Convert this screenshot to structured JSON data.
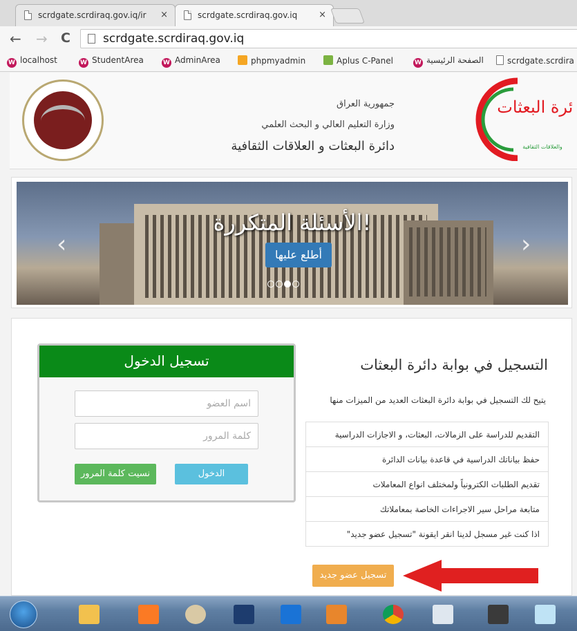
{
  "browser": {
    "tabs": [
      {
        "label": "scrdgate.scrdiraq.gov.iq/ir",
        "close": "×"
      },
      {
        "label": "scrdgate.scrdiraq.gov.iq",
        "close": "×"
      }
    ],
    "address": "scrdgate.scrdiraq.gov.iq",
    "bookmarks": [
      {
        "label": "localhost",
        "icon": "w-icon"
      },
      {
        "label": "StudentArea",
        "icon": "w-icon"
      },
      {
        "label": "AdminArea",
        "icon": "w-icon"
      },
      {
        "label": "phpmyadmin",
        "icon": "pma-icon"
      },
      {
        "label": "Aplus C-Panel",
        "icon": "aplus-icon"
      },
      {
        "label": "الصفحة الرئيسية",
        "icon": "w-icon"
      },
      {
        "label": "scrdgate.scrdira",
        "icon": "page-icon"
      }
    ]
  },
  "header": {
    "republic": "جمهورية العراق",
    "ministry": "وزارة التعليم العالي و البحث العلمي",
    "department": "دائرة البعثات و العلاقات الثقافية",
    "logo_right_text": "دائرة البعثات",
    "logo_right_sub": "والعلاقات الثقافية"
  },
  "slider": {
    "caption": "الأسئلة المتكررة!",
    "cta": "أطلع عليها",
    "dot_count": 4,
    "active_dot": 3,
    "prev": "‹",
    "next": "›"
  },
  "login": {
    "title": "تسجيل الدخول",
    "username_placeholder": "اسم العضو",
    "password_placeholder": "كلمة المرور",
    "login_button": "الدخول",
    "forgot_button": "نسيت كلمة المرور"
  },
  "registration": {
    "title": "التسجيل في بوابة دائرة البعثات",
    "subtitle": "يتيح لك التسجيل في بوابة دائرة البعثات العديد من الميزات منها",
    "features": [
      "التقديم للدراسة على الزمالات، البعثات، و الاجازات الدراسية",
      "حفظ بياناتك الدراسية في قاعدة بيانات الدائرة",
      "تقديم الطلبات الكترونياً ولمختلف انواع المعاملات",
      "متابعة مراحل سير الاجراءات الخاصة بمعاملاتك",
      "اذا كنت غير مسجل لدينا انقر ايقونة \"تسجيل عضو جديد\""
    ],
    "register_button": "تسجيل عضو جديد"
  },
  "colors": {
    "login_header": "#0a8a18",
    "login_button": "#5bc0de",
    "forgot_button": "#5cb85c",
    "register_button": "#f0ad4e",
    "arrow": "#e02020",
    "slide_button": "#337ab7"
  },
  "taskbar": {
    "items": [
      "start-orb-icon",
      "file-explorer-icon",
      "xampp-icon",
      "paint-icon",
      "remote-desktop-icon",
      "teamviewer-icon",
      "media-player-icon",
      "chrome-icon",
      "window-icon",
      "sublime-text-icon",
      "notepad-icon"
    ]
  }
}
